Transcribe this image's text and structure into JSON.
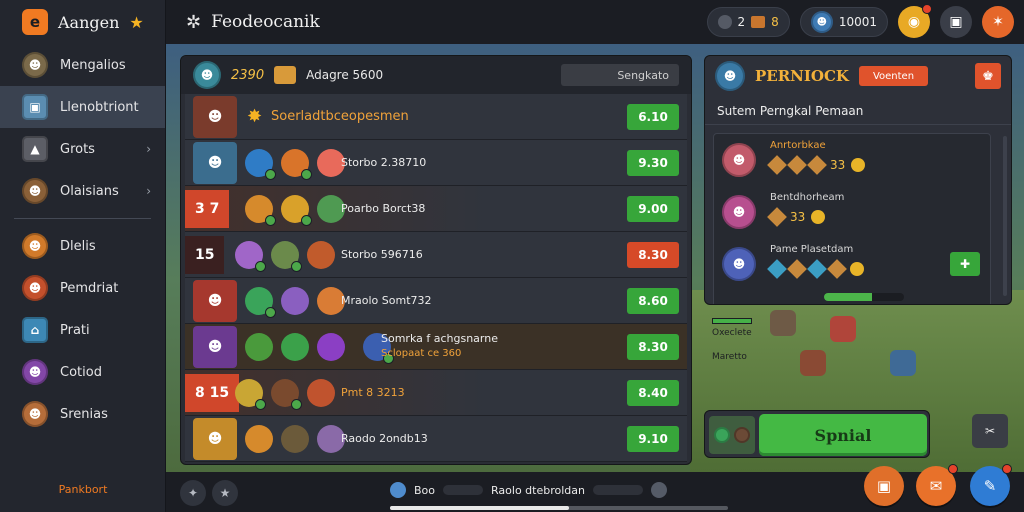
{
  "brand": {
    "name": "Aangen",
    "logo_letter": "e"
  },
  "colors": {
    "accent": "#f07a22",
    "green": "#37a63a",
    "red": "#d64a28",
    "gold": "#f5c046"
  },
  "sidebar": {
    "items": [
      {
        "label": "Mengalios",
        "icon": "hero-avatar-icon",
        "color": "#7b6a4a"
      },
      {
        "label": "Llenobtriont",
        "icon": "tower-icon",
        "color": "#5b8db1"
      },
      {
        "label": "Grots",
        "icon": "cannon-icon",
        "color": "#5c5e66",
        "chevron": true
      },
      {
        "label": "Olaisians",
        "icon": "warrior-icon",
        "color": "#8a6038",
        "chevron": true
      },
      {
        "label": "Dlelis",
        "icon": "fox-icon",
        "color": "#d17a2a"
      },
      {
        "label": "Pemdriat",
        "icon": "ranger-icon",
        "color": "#c4502c"
      },
      {
        "label": "Prati",
        "icon": "house-icon",
        "color": "#3d88b5"
      },
      {
        "label": "Cotiod",
        "icon": "mage-icon",
        "color": "#8347a8"
      },
      {
        "label": "Srenias",
        "icon": "girl-icon",
        "color": "#b56d3a"
      }
    ],
    "footer": "Pankbort"
  },
  "topbar": {
    "title": "Feodeocanik",
    "gold_text": "2",
    "gold_count": "8",
    "xp": "10001"
  },
  "list": {
    "header_amount": "2390",
    "header_label": "Adagre 5600",
    "search_placeholder": "Sengkato",
    "rows": [
      {
        "type": "featured",
        "label": "Soerladtbceopesmen",
        "price": "6.10",
        "hero_color": "#7a3b2c"
      },
      {
        "label": "Storbo 2.38710",
        "price": "9.30",
        "hero_color": "#3b6d8e",
        "units": [
          "#2f7cc6",
          "#d9742a",
          "#e86a5b",
          "#e27fae"
        ]
      },
      {
        "rank": "3 7",
        "rank_style": "red",
        "label": "Poarbo Borct38",
        "price": "9.00",
        "hero_color": "#b07036",
        "units": [
          "#d68a2c",
          "#d9a12a",
          "#4f9a52"
        ]
      },
      {
        "rank": "15",
        "rank_style": "dark",
        "label": "Storbo 596716",
        "price": "8.30",
        "price_style": "red",
        "hero_color": "#5a3d8c",
        "units": [
          "#a066c8",
          "#6b8a4b",
          "#c15b2c"
        ]
      },
      {
        "label": "Mraolo Somt732",
        "price": "8.60",
        "hero_color": "#a6382e",
        "units": [
          "#3aa45a",
          "#8a5fc0",
          "#d97c35"
        ]
      },
      {
        "type": "highlight",
        "label": "Somrka f achgsnarne",
        "sub": "Sclopaat ce 360",
        "price": "8.30",
        "hero_color": "#6b3a90",
        "units": [
          "#4a9a3c",
          "#3ba14a",
          "#8b3fc4",
          "#3b5fb0"
        ]
      },
      {
        "rank": "8 15",
        "rank_style": "red",
        "label": "Pmt 8 3213",
        "label_style": "gold",
        "price": "8.40",
        "hero_color": "#c7c43c",
        "units": [
          "#c9a634",
          "#7a4a2e",
          "#c0532e"
        ]
      },
      {
        "label": "Raodo 2ondb13",
        "price": "9.10",
        "hero_color": "#c48b2a",
        "units": [
          "#d68a2c",
          "#6b5a3a",
          "#8a6aa8"
        ]
      }
    ]
  },
  "side_panel": {
    "title": "PERNIOCK",
    "button_label": "Voenten",
    "subtitle": "Sutem Perngkal Pemaan",
    "items": [
      {
        "name": "Anrtorbkae",
        "bonus": "33",
        "avatar_color": "#c25b6b"
      },
      {
        "name": "Bentdhorheam",
        "bonus": "33",
        "avatar_color": "#b74f8f"
      },
      {
        "name": "Pame Plasetdam",
        "bonus": "",
        "avatar_color": "#4e62b8"
      }
    ],
    "progress": 0.6
  },
  "field": {
    "unit_label_1": "Oxeclete",
    "unit_label_2": "Maretto"
  },
  "action": {
    "spin_label": "Spnial"
  },
  "bottom": {
    "status_label": "Raolo dtebroldan",
    "status_prefix": "Boo",
    "progress": 0.53
  }
}
